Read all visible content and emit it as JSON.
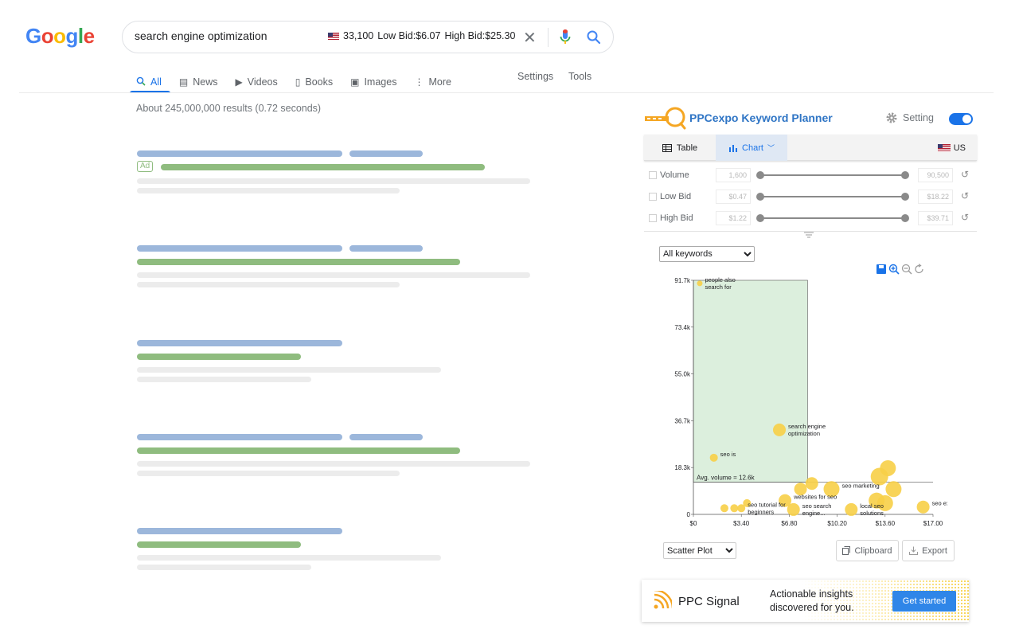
{
  "google": {
    "logo_letters": [
      {
        "ch": "G",
        "color": "#4285F4"
      },
      {
        "ch": "o",
        "color": "#EA4335"
      },
      {
        "ch": "o",
        "color": "#FBBC05"
      },
      {
        "ch": "g",
        "color": "#4285F4"
      },
      {
        "ch": "l",
        "color": "#34A853"
      },
      {
        "ch": "e",
        "color": "#EA4335"
      }
    ],
    "search": {
      "query": "search engine optimization",
      "volume": "33,100",
      "low_bid": "Low Bid:$6.07",
      "high_bid": "High Bid:$25.30"
    },
    "tabs": [
      {
        "label": "All",
        "icon": "search-icon",
        "active": true
      },
      {
        "label": "News",
        "icon": "news-icon",
        "active": false
      },
      {
        "label": "Videos",
        "icon": "video-icon",
        "active": false
      },
      {
        "label": "Books",
        "icon": "book-icon",
        "active": false
      },
      {
        "label": "Images",
        "icon": "image-icon",
        "active": false
      },
      {
        "label": "More",
        "icon": "more-icon",
        "active": false
      }
    ],
    "tools": {
      "settings": "Settings",
      "tools": "Tools"
    },
    "result_stats": "About 245,000,000 results (0.72 seconds)",
    "ad_label": "Ad"
  },
  "ppc": {
    "title": "PPCexpo Keyword Planner",
    "setting_label": "Setting",
    "view_table": "Table",
    "view_chart": "Chart",
    "country": "US",
    "filters": [
      {
        "label": "Volume",
        "min": "1,600",
        "max": "90,500"
      },
      {
        "label": "Low Bid",
        "min": "$0.47",
        "max": "$18.22"
      },
      {
        "label": "High Bid",
        "min": "$1.22",
        "max": "$39.71"
      }
    ],
    "keyword_filter": "All keywords",
    "chart_type": "Scatter Plot",
    "clipboard": "Clipboard",
    "export": "Export"
  },
  "chart_data": {
    "type": "scatter",
    "x_ticks": [
      "$0",
      "$3.40",
      "$6.80",
      "$10.20",
      "$13.60",
      "$17.00"
    ],
    "y_ticks": [
      "0",
      "18.3k",
      "36.7k",
      "55.0k",
      "73.4k",
      "91.7k"
    ],
    "xlim": [
      0,
      17
    ],
    "ylim": [
      0,
      91700
    ],
    "highlight_region": {
      "x": [
        0,
        8.1
      ],
      "y": [
        12600,
        91700
      ]
    },
    "avg_line_label": "Avg. volume = 12.6k",
    "avg_volume": 12600,
    "points": [
      {
        "x": 0.45,
        "y": 90500,
        "r": 3.5,
        "label": [
          "people also",
          "search for"
        ]
      },
      {
        "x": 6.1,
        "y": 33100,
        "r": 8,
        "label": [
          "search engine",
          "optimization"
        ]
      },
      {
        "x": 1.45,
        "y": 22200,
        "r": 5,
        "label": [
          "seo is"
        ]
      },
      {
        "x": 8.4,
        "y": 12100,
        "r": 8,
        "label": []
      },
      {
        "x": 7.6,
        "y": 9900,
        "r": 8,
        "label": []
      },
      {
        "x": 9.8,
        "y": 9900,
        "r": 10,
        "label": [
          "seo marketing"
        ]
      },
      {
        "x": 13.8,
        "y": 18100,
        "r": 10,
        "label": []
      },
      {
        "x": 13.2,
        "y": 14800,
        "r": 11,
        "label": []
      },
      {
        "x": 14.2,
        "y": 9900,
        "r": 10,
        "label": []
      },
      {
        "x": 6.5,
        "y": 5400,
        "r": 8,
        "label": [
          "websites for seo"
        ]
      },
      {
        "x": 13.0,
        "y": 5400,
        "r": 10,
        "label": []
      },
      {
        "x": 13.6,
        "y": 4400,
        "r": 10,
        "label": []
      },
      {
        "x": 16.3,
        "y": 2900,
        "r": 8,
        "label": [
          "seo expert"
        ]
      },
      {
        "x": 3.8,
        "y": 4400,
        "r": 5,
        "label": []
      },
      {
        "x": 2.2,
        "y": 2400,
        "r": 5,
        "label": []
      },
      {
        "x": 2.9,
        "y": 2400,
        "r": 5,
        "label": []
      },
      {
        "x": 3.4,
        "y": 2400,
        "r": 5,
        "label": [
          "seo tutorial for",
          "beginners"
        ]
      },
      {
        "x": 7.1,
        "y": 1900,
        "r": 8,
        "label": [
          "seo search",
          "engine..."
        ]
      },
      {
        "x": 11.2,
        "y": 1900,
        "r": 8,
        "label": [
          "local seo",
          "solutions"
        ]
      }
    ]
  },
  "banner": {
    "brand": "PPC Signal",
    "line1": "Actionable insights",
    "line2": "discovered for you.",
    "cta": "Get started"
  }
}
